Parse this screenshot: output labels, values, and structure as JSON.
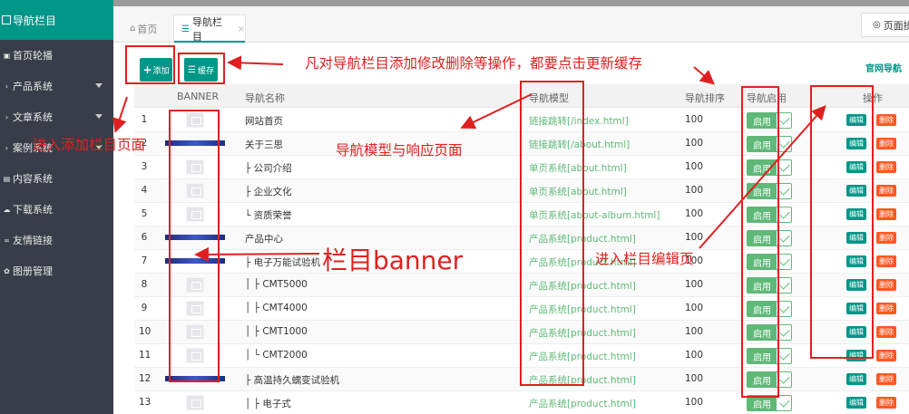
{
  "sidebar": {
    "title": "导航栏目",
    "items": [
      {
        "label": "首页轮播",
        "icon": "image-icon",
        "has_arrow": false
      },
      {
        "label": "产品系统",
        "icon": "chevron-right-icon",
        "has_arrow": true
      },
      {
        "label": "文章系统",
        "icon": "chevron-right-icon",
        "has_arrow": true
      },
      {
        "label": "案例系统",
        "icon": "chevron-right-icon",
        "has_arrow": true
      },
      {
        "label": "内容系统",
        "icon": "content-icon",
        "has_arrow": false
      },
      {
        "label": "下载系统",
        "icon": "cloud-download-icon",
        "has_arrow": false
      },
      {
        "label": "友情链接",
        "icon": "link-icon",
        "has_arrow": false
      },
      {
        "label": "图册管理",
        "icon": "album-icon",
        "has_arrow": false
      }
    ]
  },
  "tabs": [
    {
      "label": "首页",
      "icon": "home-icon",
      "active": false
    },
    {
      "label": "导航栏目",
      "icon": "menu-icon",
      "active": true,
      "close": "×"
    }
  ],
  "page_ops": {
    "label": "页面操"
  },
  "toolbar": {
    "add_label": "添加",
    "cache_label": "缓存",
    "site_link": "官网导航"
  },
  "table": {
    "headers": {
      "banner": "BANNER",
      "name": "导航名称",
      "model": "导航模型",
      "sort": "导航排序",
      "enabled": "导航启用",
      "ops": "操作"
    },
    "rows": [
      {
        "num": "1",
        "banner": "placeholder",
        "name": "网站首页",
        "model": "链接跳转[/index.html]",
        "sort": "100",
        "enabled": "启用"
      },
      {
        "num": "2",
        "banner": "image",
        "name": "关于三思",
        "model": "链接跳转[/about.html]",
        "sort": "100",
        "enabled": "启用"
      },
      {
        "num": "3",
        "banner": "placeholder",
        "name": "├ 公司介绍",
        "model": "单页系统[about.html]",
        "sort": "100",
        "enabled": "启用"
      },
      {
        "num": "4",
        "banner": "placeholder",
        "name": "├ 企业文化",
        "model": "单页系统[about.html]",
        "sort": "100",
        "enabled": "启用"
      },
      {
        "num": "5",
        "banner": "placeholder",
        "name": "└ 资质荣誉",
        "model": "单页系统[about-album.html]",
        "sort": "100",
        "enabled": "启用"
      },
      {
        "num": "6",
        "banner": "image",
        "name": "产品中心",
        "model": "产品系统[product.html]",
        "sort": "100",
        "enabled": "启用"
      },
      {
        "num": "7",
        "banner": "image",
        "name": "├ 电子万能试验机",
        "model": "产品系统[product.html]",
        "sort": "100",
        "enabled": "启用"
      },
      {
        "num": "8",
        "banner": "placeholder",
        "name": "│ ├ CMT5000",
        "model": "产品系统[product.html]",
        "sort": "100",
        "enabled": "启用"
      },
      {
        "num": "9",
        "banner": "placeholder",
        "name": "│ ├ CMT4000",
        "model": "产品系统[product.html]",
        "sort": "100",
        "enabled": "启用"
      },
      {
        "num": "10",
        "banner": "placeholder",
        "name": "│ ├ CMT1000",
        "model": "产品系统[product.html]",
        "sort": "100",
        "enabled": "启用"
      },
      {
        "num": "11",
        "banner": "placeholder",
        "name": "│ └ CMT2000",
        "model": "产品系统[product.html]",
        "sort": "100",
        "enabled": "启用"
      },
      {
        "num": "12",
        "banner": "image",
        "name": "├ 高温持久蠕变试验机",
        "model": "产品系统[product.html]",
        "sort": "100",
        "enabled": "启用"
      },
      {
        "num": "13",
        "banner": "placeholder",
        "name": "│ ├ 电子式",
        "model": "产品系统[product.html]",
        "sort": "100",
        "enabled": "启用"
      }
    ],
    "edit_label": "编辑",
    "delete_label": "删除"
  },
  "annotations": {
    "cache_note": "凡对导航栏目添加修改删除等操作，都要点击更新缓存",
    "add_note": "进入添加栏目页面",
    "model_note": "导航模型与响应页面",
    "banner_note": "栏目banner",
    "edit_note": "进入栏目编辑页"
  },
  "colors": {
    "sidebar_bg": "#393d49",
    "accent": "#009688",
    "enabled_green": "#5fb878",
    "delete_orange": "#ff5722",
    "annotation_red": "#e02020"
  }
}
